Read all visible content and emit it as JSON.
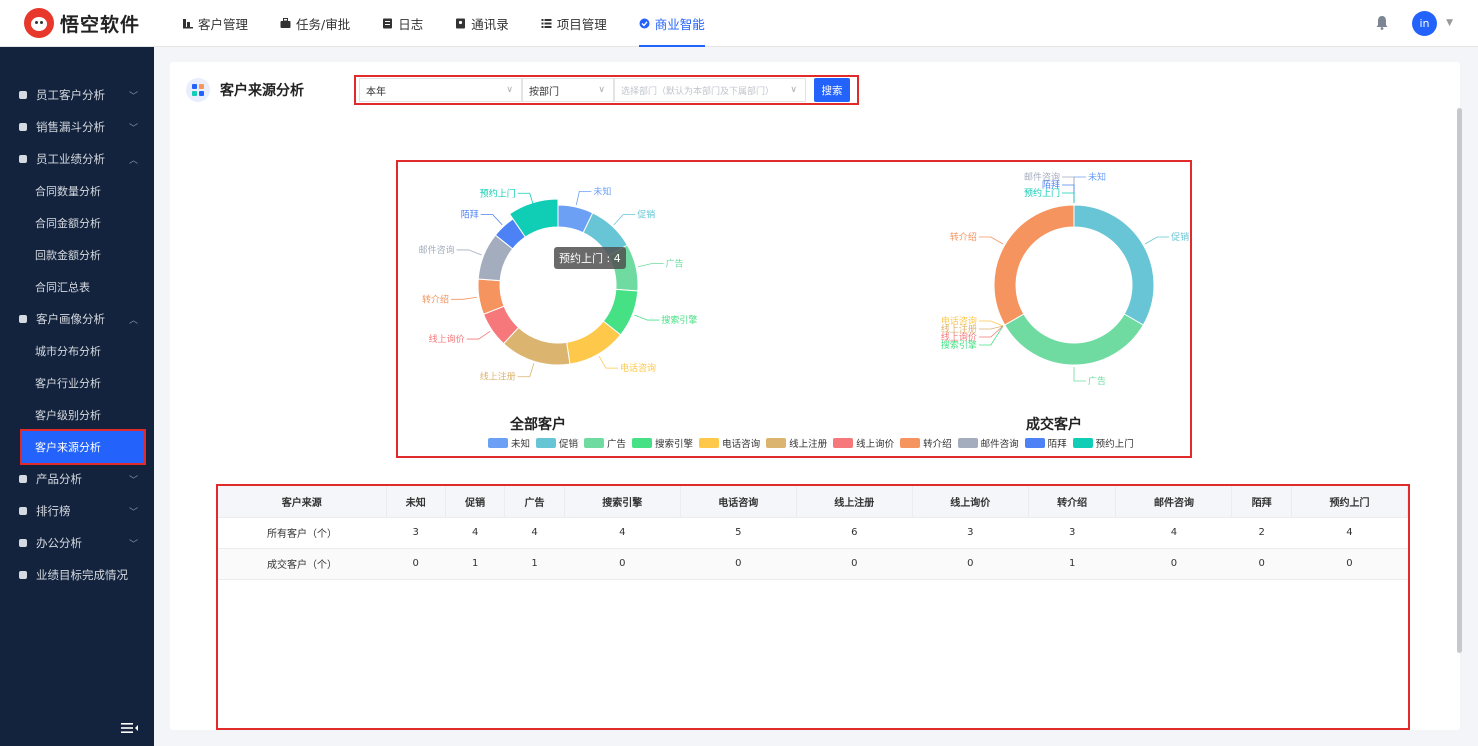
{
  "app": {
    "logo_text": "悟空软件",
    "avatar_text": "in"
  },
  "nav": [
    {
      "label": "客户管理",
      "icon": "customer-icon"
    },
    {
      "label": "任务/审批",
      "icon": "briefcase-icon"
    },
    {
      "label": "日志",
      "icon": "log-icon"
    },
    {
      "label": "通讯录",
      "icon": "contacts-icon"
    },
    {
      "label": "项目管理",
      "icon": "project-icon"
    },
    {
      "label": "商业智能",
      "icon": "bi-icon",
      "active": true
    }
  ],
  "sidebar": {
    "groups": [
      {
        "label": "员工客户分析",
        "icon": "user-icon",
        "expanded": false
      },
      {
        "label": "销售漏斗分析",
        "icon": "funnel-icon",
        "expanded": false
      },
      {
        "label": "员工业绩分析",
        "icon": "bar-icon",
        "expanded": true,
        "items": [
          "合同数量分析",
          "合同金额分析",
          "回款金额分析",
          "合同汇总表"
        ]
      },
      {
        "label": "客户画像分析",
        "icon": "users-icon",
        "expanded": true,
        "items": [
          "城市分布分析",
          "客户行业分析",
          "客户级别分析",
          "客户来源分析"
        ],
        "active_item": "客户来源分析"
      },
      {
        "label": "产品分析",
        "icon": "product-icon",
        "expanded": false
      },
      {
        "label": "排行榜",
        "icon": "trophy-icon",
        "expanded": false
      },
      {
        "label": "办公分析",
        "icon": "office-icon",
        "expanded": false
      },
      {
        "label": "业绩目标完成情况",
        "icon": "target-icon",
        "expanded": null
      }
    ]
  },
  "page": {
    "title": "客户来源分析"
  },
  "filters": {
    "period": "本年",
    "group_by": "按部门",
    "dept_placeholder": "选择部门（默认为本部门及下属部门）",
    "search_label": "搜索"
  },
  "chart_data": [
    {
      "type": "pie",
      "title": "全部客户",
      "categories": [
        "未知",
        "促销",
        "广告",
        "搜索引擎",
        "电话咨询",
        "线上注册",
        "线上询价",
        "转介绍",
        "邮件咨询",
        "陌拜",
        "预约上门"
      ],
      "values": [
        3,
        4,
        4,
        4,
        5,
        6,
        3,
        3,
        4,
        2,
        4
      ],
      "tooltip": "预约上门 : 4"
    },
    {
      "type": "pie",
      "title": "成交客户",
      "categories": [
        "未知",
        "促销",
        "广告",
        "搜索引擎",
        "电话咨询",
        "线上注册",
        "线上询价",
        "转介绍",
        "邮件咨询",
        "陌拜",
        "预约上门"
      ],
      "values": [
        0,
        1,
        1,
        0,
        0,
        0,
        0,
        1,
        0,
        0,
        0
      ]
    }
  ],
  "colors": [
    "#6ca0f5",
    "#67c5d6",
    "#6fdba1",
    "#46e085",
    "#fec84b",
    "#dbb470",
    "#f6787a",
    "#f5945f",
    "#a4adbd",
    "#4d82f6",
    "#10cdb5"
  ],
  "table": {
    "header_first": "客户来源",
    "rows": [
      {
        "label": "所有客户（个）",
        "values": [
          "3",
          "4",
          "4",
          "4",
          "5",
          "6",
          "3",
          "3",
          "4",
          "2",
          "4"
        ]
      },
      {
        "label": "成交客户（个）",
        "values": [
          "0",
          "1",
          "1",
          "0",
          "0",
          "0",
          "0",
          "1",
          "0",
          "0",
          "0"
        ]
      }
    ]
  }
}
